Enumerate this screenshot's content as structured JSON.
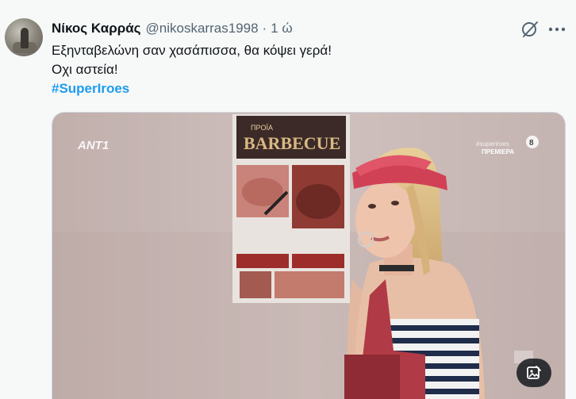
{
  "tweet": {
    "author_name": "Νίκος Καρράς",
    "author_handle": "@nikoskarras1998",
    "separator": "·",
    "time": "1 ώ",
    "lines": [
      "Εξηνταβελώνη σαν χασάπισσα, θα κόψει γερά!",
      "Οχι αστεία!"
    ],
    "hashtag": "#SuperIroes"
  },
  "media": {
    "channel_logo": "ANT1",
    "overlay_tag": "#superiroes",
    "overlay_label": "ΠΡΕΜΙΕΡΑ",
    "rating": "8",
    "poster_title_small": "ΠΡΟΪΑ",
    "poster_title": "BARBECUE",
    "alt_edit_icon": "image-edit-icon"
  },
  "colors": {
    "accent": "#1d9bf0",
    "secondary_text": "#536471",
    "background": "#f7f9f9"
  },
  "icons": {
    "grok": "grok-icon",
    "more": "more-icon"
  }
}
